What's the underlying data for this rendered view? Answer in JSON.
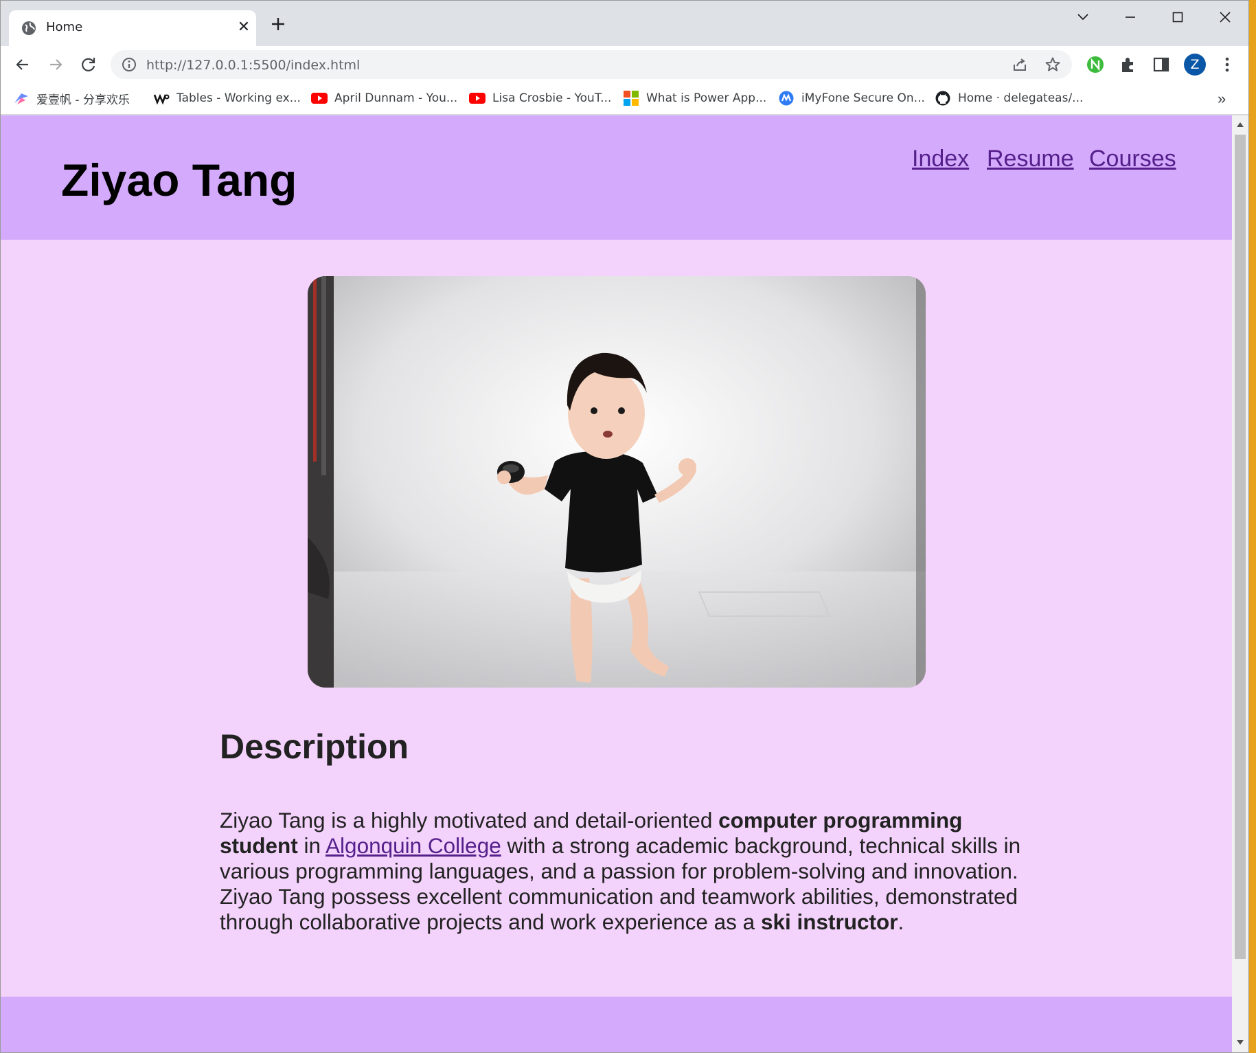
{
  "browser": {
    "tab_title": "Home",
    "url": "http://127.0.0.1:5500/index.html",
    "profile_initial": "Z",
    "bookmarks": [
      "爱壹帆 - 分享欢乐",
      "Tables - Working ex...",
      "April Dunnam - You...",
      "Lisa Crosbie - YouT...",
      "What is Power App...",
      "iMyFone Secure On...",
      "Home · delegateas/..."
    ],
    "bookmarks_overflow": "»"
  },
  "page": {
    "site_name": "Ziyao Tang",
    "nav": [
      "Index",
      "Resume",
      "Courses"
    ],
    "description_heading": "Description",
    "description": {
      "part1": "Ziyao Tang is a highly motivated and detail-oriented ",
      "bold1": "computer programming student",
      "part2": " in ",
      "link": "Algonquin College",
      "part3": " with a strong academic background, technical skills in various programming languages, and a passion for problem-solving and innovation. Ziyao Tang possess excellent communication and teamwork abilities, demonstrated through collaborative projects and work experience as a ",
      "bold2": "ski instructor",
      "part4": "."
    }
  },
  "colors": {
    "header_bg": "#d4aafc",
    "page_bg": "#f3d2fb",
    "link": "#55208b"
  }
}
